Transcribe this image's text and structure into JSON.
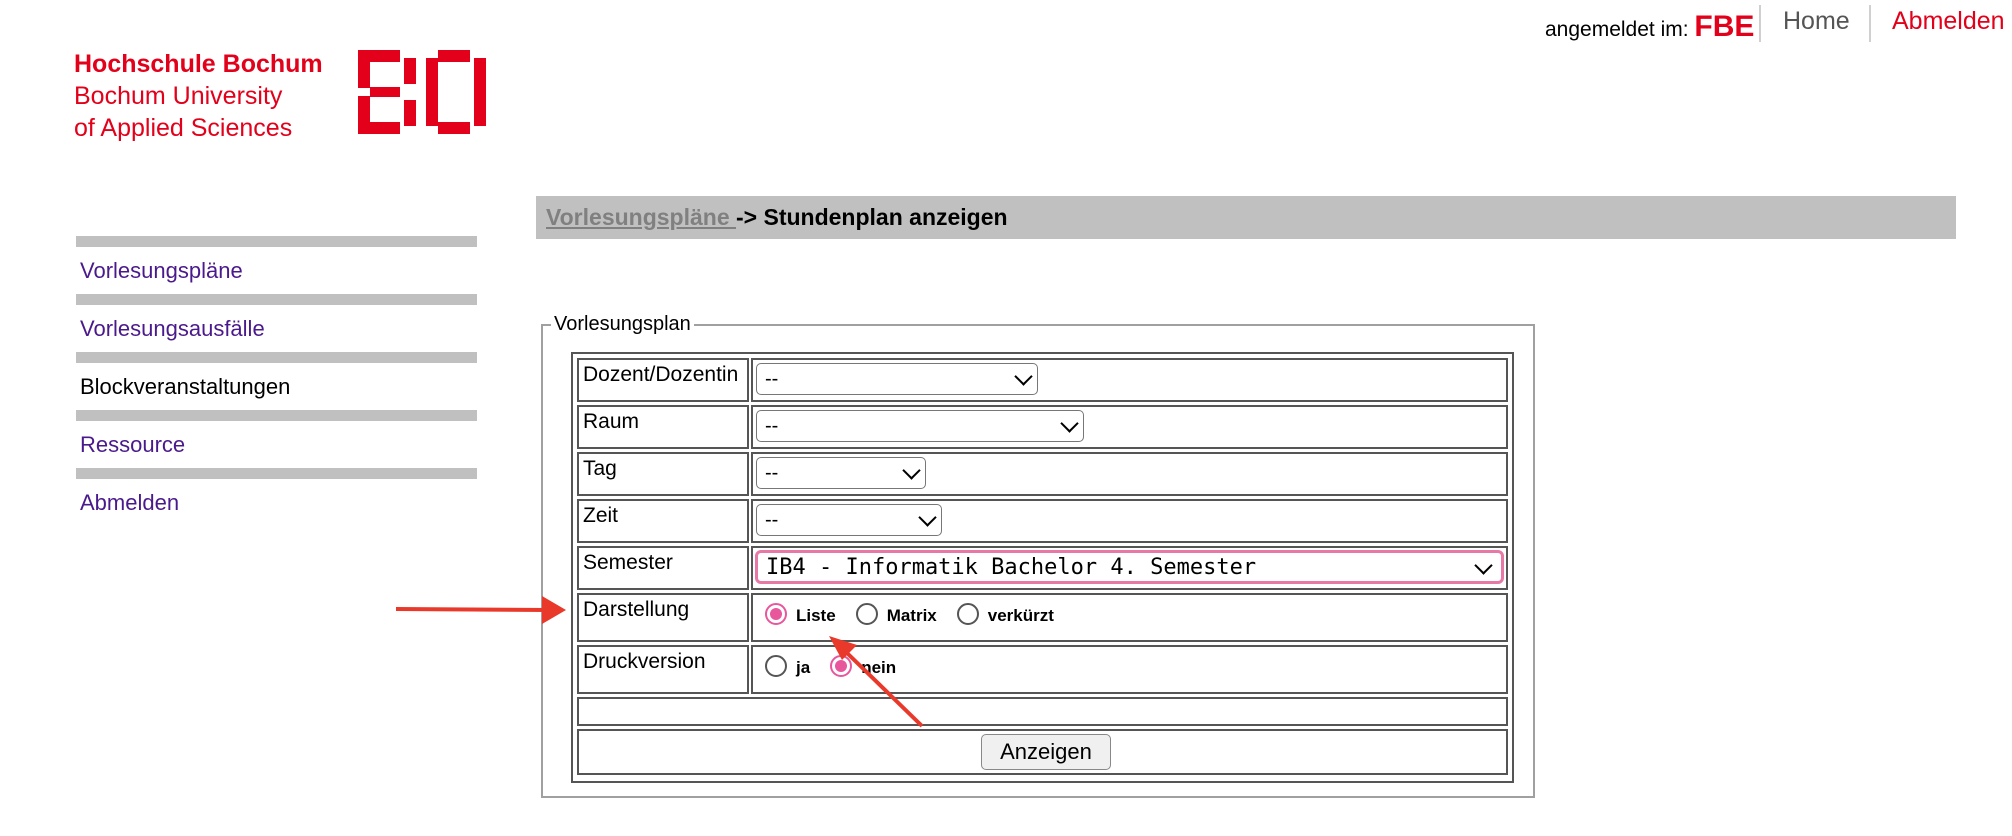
{
  "header": {
    "logged_in_label": "angemeldet im:",
    "faculty": "FBE",
    "home": "Home",
    "logout": "Abmelden"
  },
  "logo": {
    "line1": "Hochschule Bochum",
    "line2": "Bochum University",
    "line3": "of Applied Sciences",
    "mark_text": "BO"
  },
  "sidebar": {
    "items": [
      {
        "label": "Vorlesungspläne"
      },
      {
        "label": "Vorlesungsausfälle"
      },
      {
        "label": "Blockveranstaltungen"
      },
      {
        "label": "Ressource"
      },
      {
        "label": "Abmelden"
      }
    ]
  },
  "breadcrumb": {
    "link": "Vorlesungspläne ",
    "current": "-> Stundenplan anzeigen"
  },
  "form": {
    "legend": "Vorlesungsplan",
    "rows": {
      "lecturer": {
        "label": "Dozent/Dozentin",
        "value": "--"
      },
      "room": {
        "label": "Raum",
        "value": "--"
      },
      "day": {
        "label": "Tag",
        "value": "--"
      },
      "time": {
        "label": "Zeit",
        "value": "--"
      },
      "semester": {
        "label": "Semester",
        "value": "IB4 - Informatik Bachelor 4. Semester"
      },
      "display": {
        "label": "Darstellung",
        "options": [
          "Liste",
          "Matrix",
          "verkürzt"
        ],
        "selected": "Liste"
      },
      "print": {
        "label": "Druckversion",
        "options": [
          "ja",
          "nein"
        ],
        "selected": "nein"
      }
    },
    "submit": "Anzeigen"
  },
  "colors": {
    "brand_red": "#e2001a",
    "link_purple": "#4a1a8c",
    "radio_pink": "#e8579b",
    "annotation_arrow": "#e8392a"
  }
}
